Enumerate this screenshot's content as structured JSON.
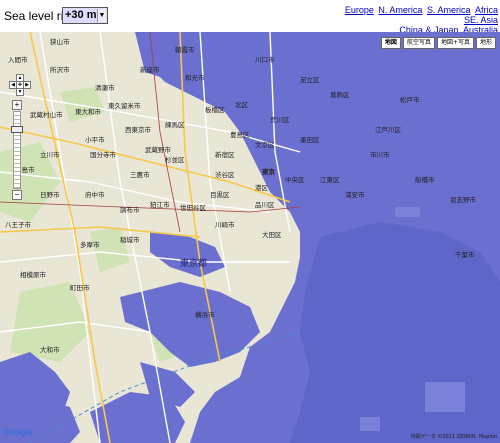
{
  "controls": {
    "sea_level_label": "Sea level rise:",
    "sea_level_value": "+30 m",
    "region_links": [
      "Europe",
      "N. America",
      "S. America",
      "Africa",
      "SE. Asia",
      "China & Japan",
      "Australia"
    ]
  },
  "map": {
    "type_buttons": [
      "地図",
      "航空写真",
      "地図+写真",
      "地形"
    ],
    "active_type": "地図",
    "pan_glyphs": {
      "up": "▲",
      "left": "◀",
      "center": "✥",
      "right": "▶",
      "down": "▼"
    },
    "zoom_in": "+",
    "zoom_out": "−",
    "logo": "Google",
    "attribution": "地図データ ©2011 ZENRIN, Mapion",
    "flood_color": "#6a6fd0",
    "land_color": "#e9e6d6",
    "labels": [
      {
        "name": "東京都",
        "type": "prefecture"
      },
      {
        "name": "武蔵村山市",
        "type": "city"
      },
      {
        "name": "東大和市",
        "type": "city"
      },
      {
        "name": "清瀬市",
        "type": "city"
      },
      {
        "name": "東久留米市",
        "type": "city"
      },
      {
        "name": "小平市",
        "type": "city"
      },
      {
        "name": "国分寺市",
        "type": "city"
      },
      {
        "name": "立川市",
        "type": "city"
      },
      {
        "name": "府中市",
        "type": "city"
      },
      {
        "name": "調布市",
        "type": "city"
      },
      {
        "name": "三鷹市",
        "type": "city"
      },
      {
        "name": "杉並区",
        "type": "city"
      },
      {
        "name": "練馬区",
        "type": "city"
      },
      {
        "name": "板橋区",
        "type": "city"
      },
      {
        "name": "北区",
        "type": "city"
      },
      {
        "name": "世田谷区",
        "type": "city"
      },
      {
        "name": "目黒区",
        "type": "city"
      },
      {
        "name": "新宿区",
        "type": "city"
      },
      {
        "name": "渋谷区",
        "type": "city"
      },
      {
        "name": "港区",
        "type": "city"
      },
      {
        "name": "東京",
        "type": "city"
      },
      {
        "name": "品川区",
        "type": "city"
      },
      {
        "name": "大田区",
        "type": "city"
      },
      {
        "name": "町田市",
        "type": "city"
      },
      {
        "name": "多摩市",
        "type": "city"
      },
      {
        "name": "稲城市",
        "type": "city"
      },
      {
        "name": "狛江市",
        "type": "city"
      },
      {
        "name": "相模原市",
        "type": "city"
      },
      {
        "name": "大和市",
        "type": "city"
      },
      {
        "name": "川崎市",
        "type": "city"
      },
      {
        "name": "横浜市",
        "type": "city"
      },
      {
        "name": "浦安市",
        "type": "city"
      },
      {
        "name": "市川市",
        "type": "city"
      },
      {
        "name": "船橋市",
        "type": "city"
      },
      {
        "name": "習志野市",
        "type": "city"
      },
      {
        "name": "千葉市",
        "type": "city"
      },
      {
        "name": "松戸市",
        "type": "city"
      },
      {
        "name": "所沢市",
        "type": "city"
      },
      {
        "name": "新座市",
        "type": "city"
      },
      {
        "name": "朝霞市",
        "type": "city"
      },
      {
        "name": "和光市",
        "type": "city"
      },
      {
        "name": "川口市",
        "type": "city"
      },
      {
        "name": "入間市",
        "type": "city"
      },
      {
        "name": "狭山市",
        "type": "city"
      },
      {
        "name": "日野市",
        "type": "city"
      },
      {
        "name": "八王子市",
        "type": "city"
      },
      {
        "name": "昭島市",
        "type": "city"
      },
      {
        "name": "西東京市",
        "type": "city"
      },
      {
        "name": "武蔵野市",
        "type": "city"
      },
      {
        "name": "豊島区",
        "type": "city"
      },
      {
        "name": "文京区",
        "type": "city"
      },
      {
        "name": "葛飾区",
        "type": "city"
      },
      {
        "name": "江戸川区",
        "type": "city"
      },
      {
        "name": "江東区",
        "type": "city"
      },
      {
        "name": "中央区",
        "type": "city"
      },
      {
        "name": "墨田区",
        "type": "city"
      },
      {
        "name": "足立区",
        "type": "city"
      },
      {
        "name": "荒川区",
        "type": "city"
      }
    ]
  }
}
